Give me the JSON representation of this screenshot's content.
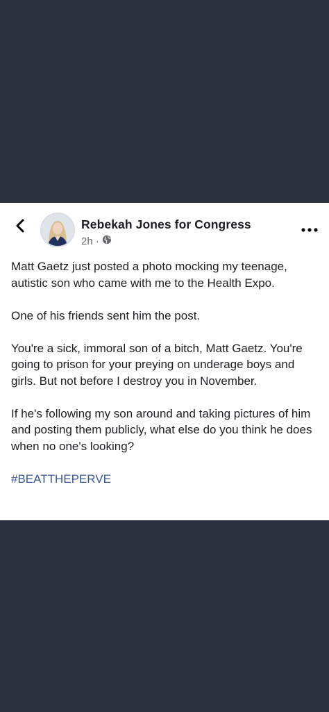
{
  "post": {
    "page_name": "Rebekah Jones for Congress",
    "time": "2h",
    "separator": "·",
    "paragraphs": [
      "Matt Gaetz just posted a photo mocking my teenage, autistic son who came with me to the Health Expo.",
      "One of his friends sent him the post.",
      "You're a sick, immoral son of a bitch, Matt Gaetz. You're going to prison for your preying on underage boys and girls. But not before I destroy you in November.",
      "If he's following my son around and taking pictures of him and posting them publicly, what else do you think he does when no one's looking?"
    ],
    "hashtag": "#BEATTHEPERVE"
  },
  "icons": {
    "back": "chevron-left-icon",
    "privacy": "globe-icon",
    "more": "more-horizontal-icon"
  },
  "colors": {
    "background": "#2e323f",
    "card": "#ffffff",
    "text": "#1c1e21",
    "secondary_text": "#65676b",
    "link": "#385898"
  }
}
